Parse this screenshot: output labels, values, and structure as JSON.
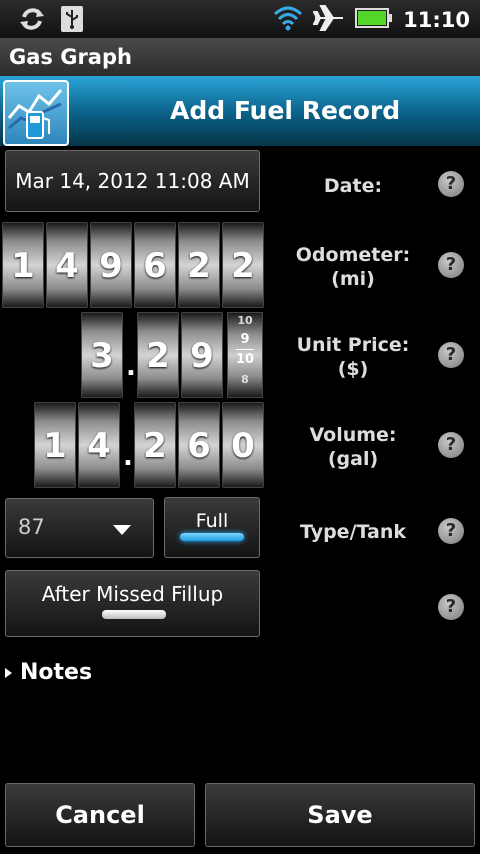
{
  "status_bar": {
    "time": "11:10",
    "left_icons": [
      "sync-icon",
      "usb-icon"
    ],
    "right_icons": [
      "wifi-icon",
      "airplane-icon",
      "battery-icon"
    ]
  },
  "app_title": "Gas Graph",
  "header": {
    "title": "Add Fuel Record",
    "icon": "gas-graph-app-icon"
  },
  "date": {
    "value": "Mar 14, 2012 11:08 AM",
    "label": "Date:"
  },
  "odometer": {
    "label_line1": "Odometer:",
    "label_line2": "(mi)",
    "digits": [
      "1",
      "4",
      "9",
      "6",
      "2",
      "2"
    ]
  },
  "unit_price": {
    "label_line1": "Unit Price:",
    "label_line2": "($)",
    "digits_before": [
      "3"
    ],
    "digits_after": [
      "2",
      "9"
    ],
    "fraction": {
      "above": "10",
      "numerator": "9",
      "denominator": "10",
      "below": "8"
    }
  },
  "volume": {
    "label_line1": "Volume:",
    "label_line2": "(gal)",
    "digits_before": [
      "1",
      "4"
    ],
    "digits_after": [
      "2",
      "6",
      "0"
    ]
  },
  "type_tank": {
    "label": "Type/Tank",
    "grade_value": "87",
    "full_label": "Full",
    "full_on": true
  },
  "missed_fillup": {
    "label": "After Missed Fillup",
    "on": false
  },
  "help_glyph": "?",
  "decimal_point": ".",
  "notes": {
    "label": "Notes"
  },
  "buttons": {
    "cancel": "Cancel",
    "save": "Save"
  },
  "colors": {
    "header_blue": "#0b5f86",
    "toggle_on": "#1a9de0",
    "background": "#000000"
  }
}
